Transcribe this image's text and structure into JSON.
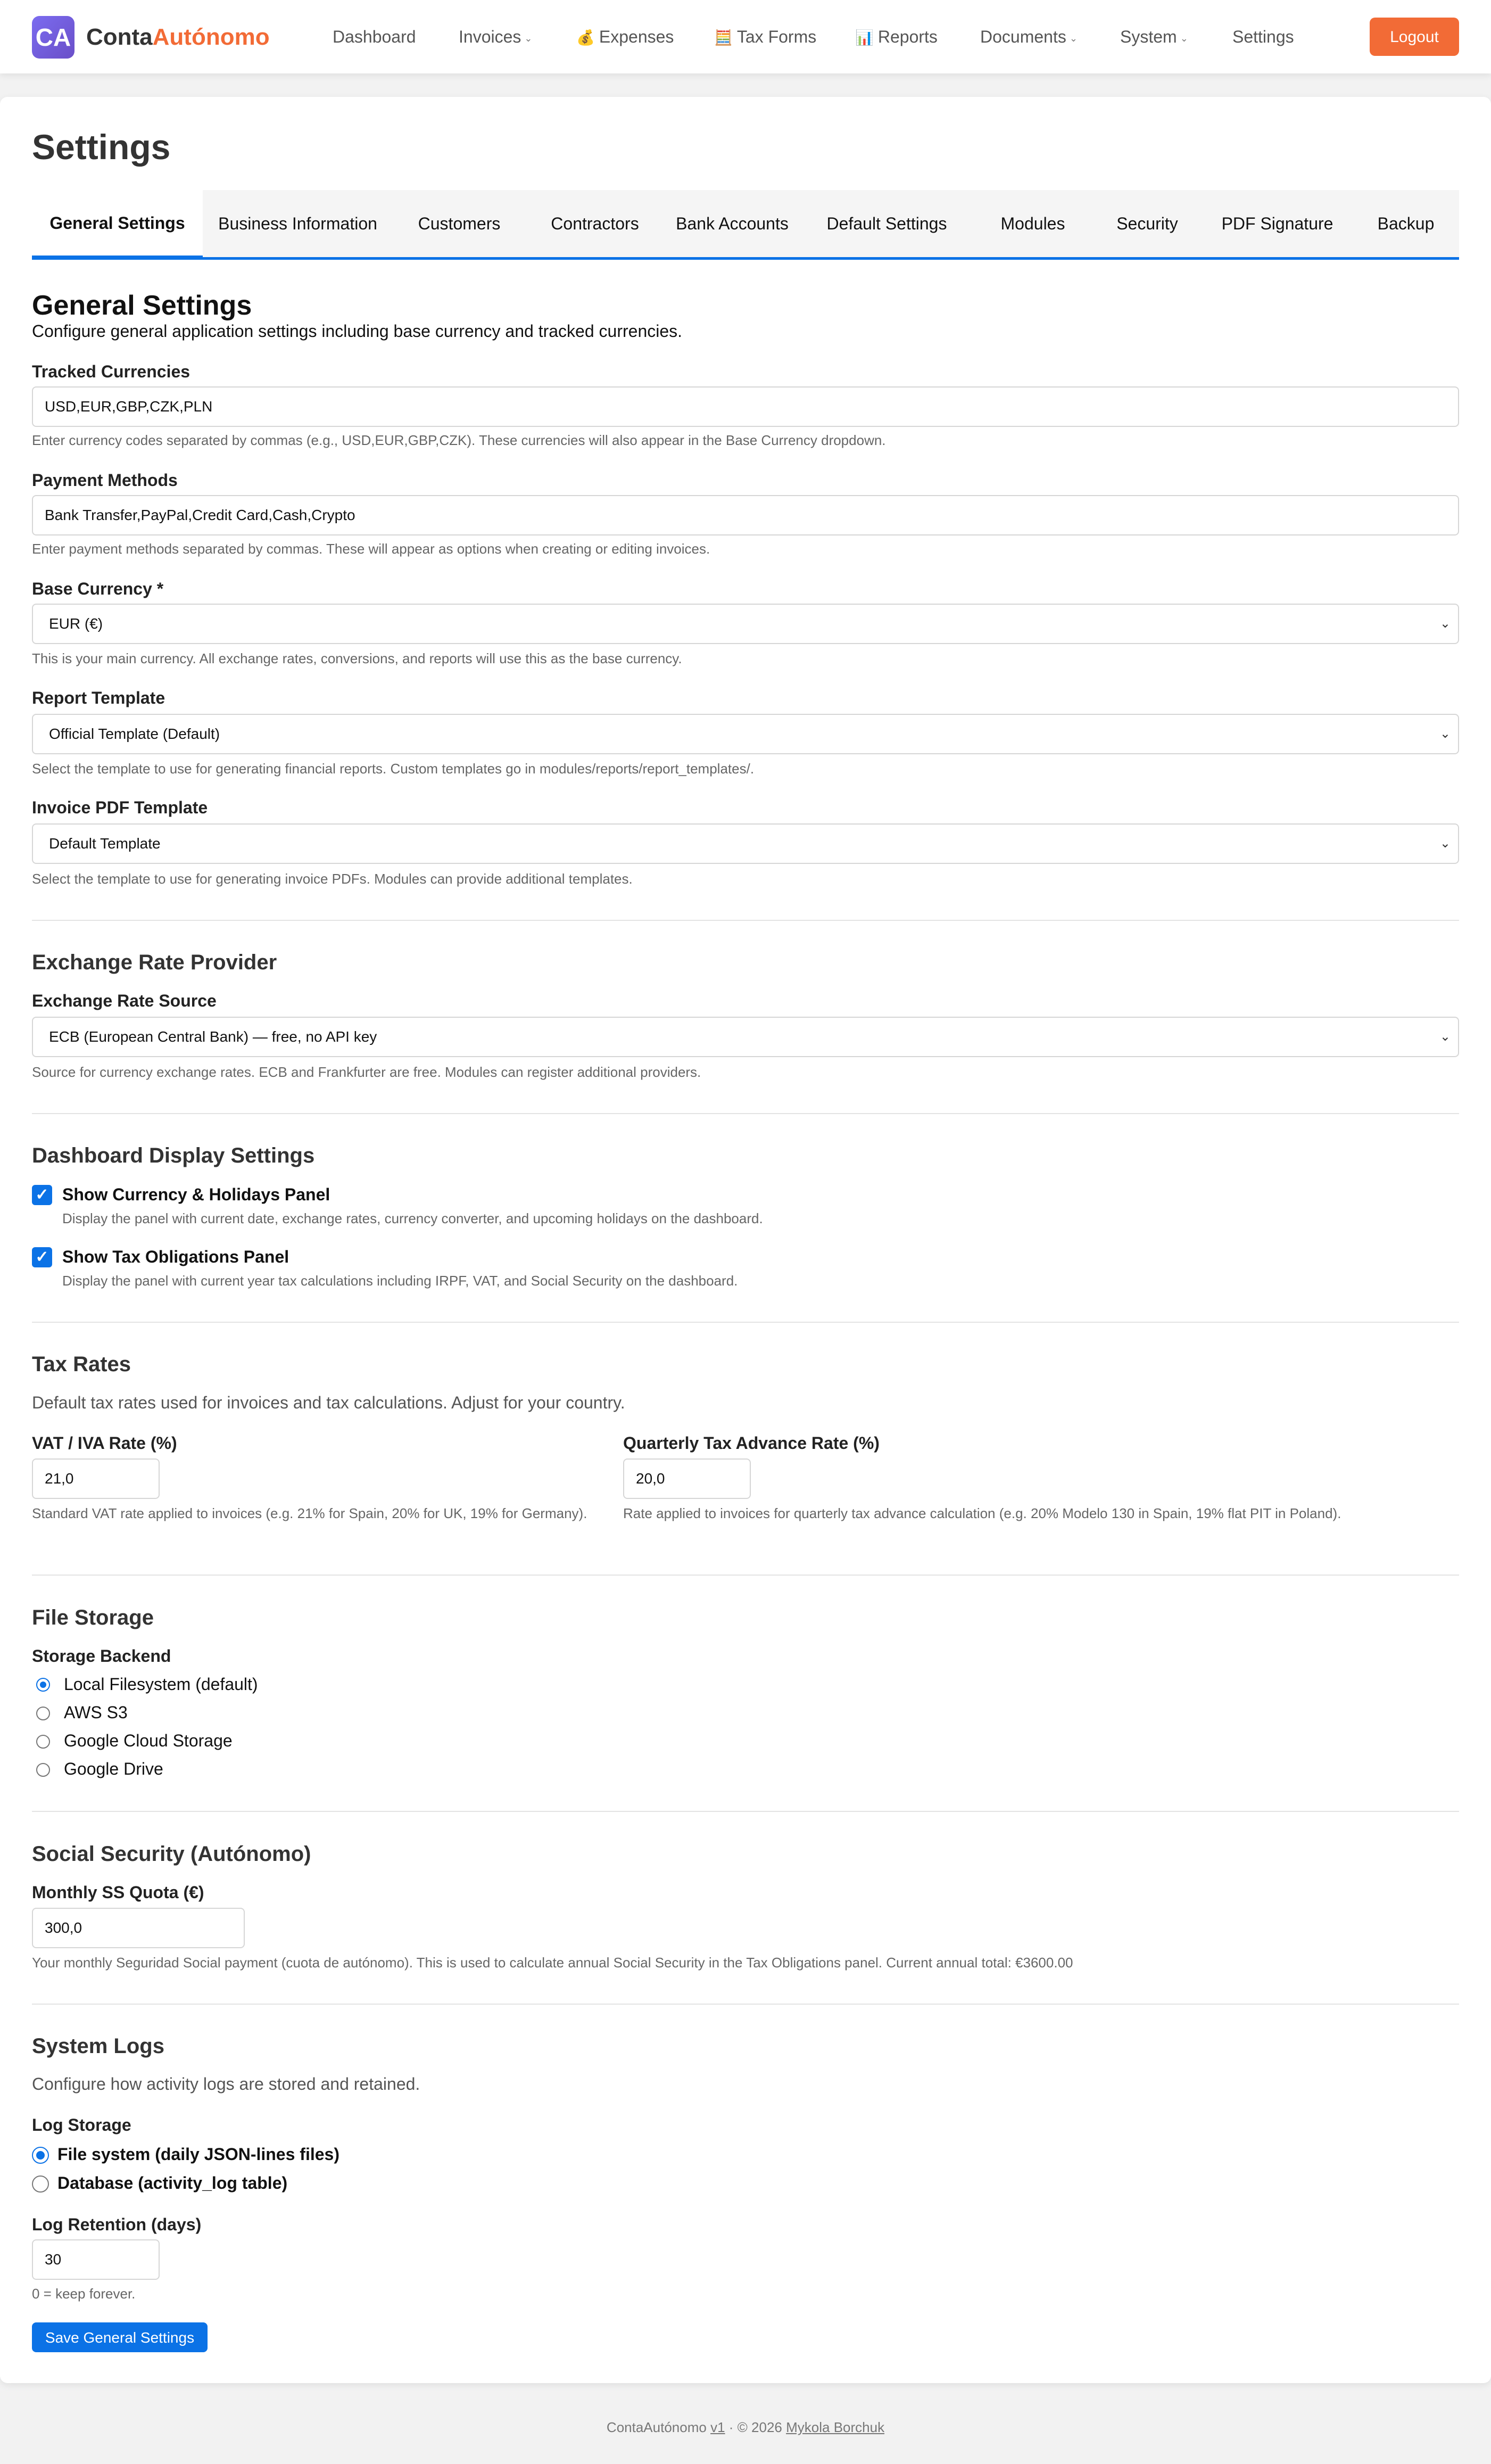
{
  "brand": {
    "logo": "CA",
    "name_part1": "Conta",
    "name_part2": "Autónomo"
  },
  "nav": {
    "items": [
      {
        "label": "Dashboard",
        "icon": "",
        "dropdown": false
      },
      {
        "label": "Invoices",
        "icon": "",
        "dropdown": true
      },
      {
        "label": "Expenses",
        "icon": "💰",
        "dropdown": false
      },
      {
        "label": "Tax Forms",
        "icon": "🧮",
        "dropdown": false
      },
      {
        "label": "Reports",
        "icon": "📊",
        "dropdown": false
      },
      {
        "label": "Documents",
        "icon": "",
        "dropdown": true
      },
      {
        "label": "System",
        "icon": "",
        "dropdown": true
      },
      {
        "label": "Settings",
        "icon": "",
        "dropdown": false
      }
    ],
    "caret": "⌄",
    "logout_label": "Logout"
  },
  "page": {
    "title": "Settings"
  },
  "tabs": [
    {
      "label": "General Settings",
      "active": true
    },
    {
      "label": "Business Information",
      "active": false
    },
    {
      "label": "Customers",
      "active": false
    },
    {
      "label": "Contractors",
      "active": false
    },
    {
      "label": "Bank Accounts",
      "active": false
    },
    {
      "label": "Default Settings",
      "active": false
    },
    {
      "label": "Modules",
      "active": false
    },
    {
      "label": "Security",
      "active": false
    },
    {
      "label": "PDF Signature",
      "active": false
    },
    {
      "label": "Backup",
      "active": false
    }
  ],
  "general": {
    "heading": "General Settings",
    "description": "Configure general application settings including base currency and tracked currencies.",
    "tracked_currencies": {
      "label": "Tracked Currencies",
      "value": "USD,EUR,GBP,CZK,PLN",
      "help": "Enter currency codes separated by commas (e.g., USD,EUR,GBP,CZK). These currencies will also appear in the Base Currency dropdown."
    },
    "payment_methods": {
      "label": "Payment Methods",
      "value": "Bank Transfer,PayPal,Credit Card,Cash,Crypto",
      "help": "Enter payment methods separated by commas. These will appear as options when creating or editing invoices."
    },
    "base_currency": {
      "label": "Base Currency *",
      "value": "EUR (€)",
      "help": "This is your main currency. All exchange rates, conversions, and reports will use this as the base currency."
    },
    "report_template": {
      "label": "Report Template",
      "value": "Official Template (Default)",
      "help": "Select the template to use for generating financial reports. Custom templates go in modules/reports/report_templates/."
    },
    "invoice_template": {
      "label": "Invoice PDF Template",
      "value": "Default Template",
      "help": "Select the template to use for generating invoice PDFs. Modules can provide additional templates."
    }
  },
  "exchange": {
    "heading": "Exchange Rate Provider",
    "label": "Exchange Rate Source",
    "value": "ECB (European Central Bank) — free, no API key",
    "help": "Source for currency exchange rates. ECB and Frankfurter are free. Modules can register additional providers."
  },
  "dashboard": {
    "heading": "Dashboard Display Settings",
    "options": [
      {
        "label": "Show Currency & Holidays Panel",
        "checked": true,
        "help": "Display the panel with current date, exchange rates, currency converter, and upcoming holidays on the dashboard."
      },
      {
        "label": "Show Tax Obligations Panel",
        "checked": true,
        "help": "Display the panel with current year tax calculations including IRPF, VAT, and Social Security on the dashboard."
      }
    ],
    "check_glyph": "✓"
  },
  "tax": {
    "heading": "Tax Rates",
    "description": "Default tax rates used for invoices and tax calculations. Adjust for your country.",
    "vat": {
      "label": "VAT / IVA Rate (%)",
      "value": "21,0",
      "help": "Standard VAT rate applied to invoices (e.g. 21% for Spain, 20% for UK, 19% for Germany)."
    },
    "advance": {
      "label": "Quarterly Tax Advance Rate (%)",
      "value": "20,0",
      "help": "Rate applied to invoices for quarterly tax advance calculation (e.g. 20% Modelo 130 in Spain, 19% flat PIT in Poland)."
    }
  },
  "storage": {
    "heading": "File Storage",
    "label": "Storage Backend",
    "options": [
      {
        "label": "Local Filesystem (default)",
        "selected": true
      },
      {
        "label": "AWS S3",
        "selected": false
      },
      {
        "label": "Google Cloud Storage",
        "selected": false
      },
      {
        "label": "Google Drive",
        "selected": false
      }
    ]
  },
  "social": {
    "heading": "Social Security (Autónomo)",
    "label": "Monthly SS Quota (€)",
    "value": "300,0",
    "help": "Your monthly Seguridad Social payment (cuota de autónomo). This is used to calculate annual Social Security in the Tax Obligations panel. Current annual total: €3600.00"
  },
  "logs": {
    "heading": "System Logs",
    "description": "Configure how activity logs are stored and retained.",
    "storage_label": "Log Storage",
    "options": [
      {
        "label": "File system (daily JSON-lines files)",
        "selected": true
      },
      {
        "label": "Database (activity_log table)",
        "selected": false
      }
    ],
    "retention_label": "Log Retention (days)",
    "retention_value": "30",
    "retention_help": "0 = keep forever."
  },
  "save_label": "Save General Settings",
  "footer": {
    "app": "ContaAutónomo",
    "version": "v1",
    "copyright": "· © 2026",
    "author": "Mykola Borchuk"
  },
  "colors": {
    "accent": "#0b72e6",
    "brand_orange": "#f26b36",
    "logo_purple": "#6a4fc8"
  }
}
